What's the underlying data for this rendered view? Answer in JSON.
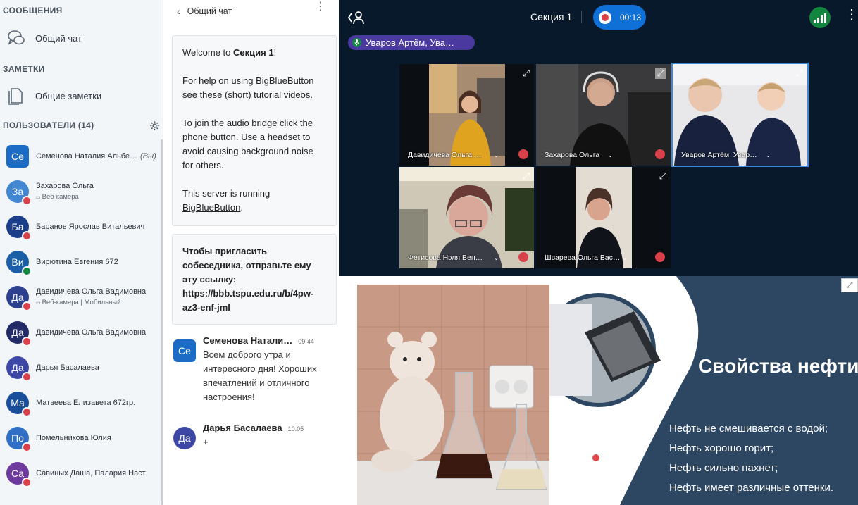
{
  "sidebar": {
    "messages_title": "СООБЩЕНИЯ",
    "public_chat": "Общий чат",
    "notes_title": "ЗАМЕТКИ",
    "shared_notes": "Общие заметки",
    "users_title": "ПОЛЬЗОВАТЕЛИ (14)",
    "users": [
      {
        "initials": "Се",
        "name": "Семенова Наталия Альбе…",
        "you": "(Вы)",
        "sub": "",
        "color": "#1c6cc5",
        "badge": ""
      },
      {
        "initials": "За",
        "name": "Захарова Ольга",
        "you": "",
        "sub": "Веб-камера",
        "color": "#4386d2",
        "badge": "mic-off"
      },
      {
        "initials": "Ба",
        "name": "Баранов Ярослав Витальевич",
        "you": "",
        "sub": "",
        "color": "#1b3e8b",
        "badge": "mic-off"
      },
      {
        "initials": "Ви",
        "name": "Вирютина Евгения 672",
        "you": "",
        "sub": "",
        "color": "#1a5ea6",
        "badge": "headset"
      },
      {
        "initials": "Да",
        "name": "Давидичева Ольга Вадимовна",
        "you": "",
        "sub": "Веб-камера | Мобильный",
        "color": "#2d3f8f",
        "badge": "mic-off"
      },
      {
        "initials": "Да",
        "name": "Давидичева Ольга Вадимовна",
        "you": "",
        "sub": "",
        "color": "#232b66",
        "badge": "mic-off"
      },
      {
        "initials": "Да",
        "name": "Дарья Басалаева",
        "you": "",
        "sub": "",
        "color": "#3d47a6",
        "badge": "mic-off"
      },
      {
        "initials": "Ма",
        "name": "Матвеева Елизавета 672гр.",
        "you": "",
        "sub": "",
        "color": "#1a4e9a",
        "badge": "mic-off"
      },
      {
        "initials": "По",
        "name": "Помельникова Юлия",
        "you": "",
        "sub": "",
        "color": "#2f6fc6",
        "badge": "mic-off"
      },
      {
        "initials": "Са",
        "name": "Савиных Даша, Палария Наст",
        "you": "",
        "sub": "",
        "color": "#6e3a9e",
        "badge": "mic-off"
      }
    ]
  },
  "chat": {
    "title": "Общий чат",
    "welcome": {
      "line1_pre": "Welcome to ",
      "line1_bold": "Секция 1",
      "line1_post": "!",
      "p2_pre": "For help on using BigBlueButton see these (short) ",
      "p2_link": "tutorial videos",
      "p2_post": ".",
      "p3": "To join the audio bridge click the phone button. Use a headset to avoid causing background noise for others.",
      "p4_pre": "This server is running ",
      "p4_link": "BigBlueButton",
      "p4_post": "."
    },
    "invite": "Чтобы пригласить собеседника, отправьте ему эту ссылку: https://bbb.tspu.edu.ru/b/4pw-az3-enf-jml",
    "messages": [
      {
        "initials": "Се",
        "name": "Семенова Натали…",
        "time": "09:44",
        "text": "Всем доброго утра и интересного дня! Хороших впечатлений и отличного настроения!",
        "color": "#1c6cc5"
      },
      {
        "initials": "Да",
        "name": "Дарья Басалаева",
        "time": "10:05",
        "text": "+",
        "color": "#3d47a6"
      }
    ]
  },
  "topbar": {
    "title": "Секция 1",
    "timer": "00:13",
    "talking": "Уваров Артём, Ува…"
  },
  "videos": [
    {
      "name": "Давидичева Ольга …"
    },
    {
      "name": "Захарова Ольга"
    },
    {
      "name": "Уваров Артём, Увар…"
    },
    {
      "name": "Фетисова Нэля Вен…"
    },
    {
      "name": "Шварева Ольга Вас…"
    }
  ],
  "slide": {
    "title": "Свойства нефти",
    "points": [
      "Нефть не смешивается с водой;",
      "Нефть хорошо горит;",
      "Нефть сильно пахнет;",
      "Нефть имеет различные оттенки."
    ]
  },
  "colors": {
    "accent": "#0f70d7",
    "dark_bg": "#07192a",
    "muted_red": "#d9414a",
    "slide_navy": "#2d4763"
  }
}
